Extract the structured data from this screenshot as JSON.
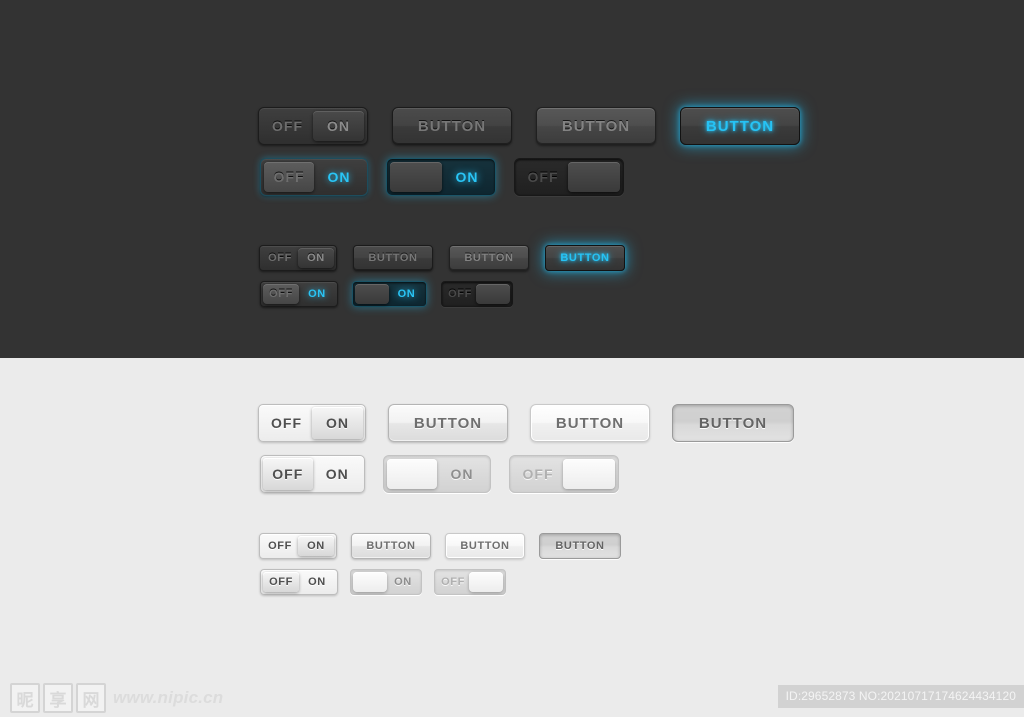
{
  "meta": {
    "background_dark": "#333333",
    "background_light": "#ebebeb",
    "accent_blue": "#29c5f6"
  },
  "labels": {
    "off": "OFF",
    "on": "ON",
    "button": "BUTTON"
  },
  "dark_section": {
    "row_large_1": [
      {
        "type": "toggle",
        "name": "toggle-off-on-knob-right",
        "left_label": "OFF",
        "right_label": "ON",
        "state": "on"
      },
      {
        "type": "button",
        "name": "button-default",
        "label": "BUTTON",
        "state": "default"
      },
      {
        "type": "button",
        "name": "button-hover",
        "label": "BUTTON",
        "state": "hover"
      },
      {
        "type": "button",
        "name": "button-active-glow",
        "label": "BUTTON",
        "state": "active"
      }
    ],
    "row_large_2": [
      {
        "type": "toggle",
        "name": "toggle-off-knob-left-on-blue",
        "left_label": "OFF",
        "right_label": "ON",
        "state": "on"
      },
      {
        "type": "pill",
        "name": "pill-on-blue",
        "label": "ON",
        "knob": "left",
        "state": "on"
      },
      {
        "type": "pill",
        "name": "pill-off-dim",
        "label": "OFF",
        "knob": "right",
        "state": "off"
      }
    ],
    "row_small_1": [
      {
        "type": "toggle",
        "name": "toggle-small-off-on",
        "left_label": "OFF",
        "right_label": "ON",
        "state": "on"
      },
      {
        "type": "button",
        "name": "button-small-default",
        "label": "BUTTON",
        "state": "default"
      },
      {
        "type": "button",
        "name": "button-small-hover",
        "label": "BUTTON",
        "state": "hover"
      },
      {
        "type": "button",
        "name": "button-small-active-glow",
        "label": "BUTTON",
        "state": "active"
      }
    ],
    "row_small_2": [
      {
        "type": "toggle",
        "name": "toggle-small-off-on-blue",
        "left_label": "OFF",
        "right_label": "ON",
        "state": "on"
      },
      {
        "type": "pill",
        "name": "pill-small-on-blue",
        "label": "ON",
        "knob": "left",
        "state": "on"
      },
      {
        "type": "pill",
        "name": "pill-small-off-dim",
        "label": "OFF",
        "knob": "right",
        "state": "off"
      }
    ]
  },
  "light_section": {
    "row_large_1": [
      {
        "type": "toggle",
        "name": "toggle-off-on-knob-right",
        "left_label": "OFF",
        "right_label": "ON",
        "state": "on"
      },
      {
        "type": "button",
        "name": "button-default",
        "label": "BUTTON",
        "state": "default"
      },
      {
        "type": "button",
        "name": "button-hover",
        "label": "BUTTON",
        "state": "hover"
      },
      {
        "type": "button",
        "name": "button-pressed",
        "label": "BUTTON",
        "state": "pressed"
      }
    ],
    "row_large_2": [
      {
        "type": "toggle",
        "name": "toggle-off-knob-left",
        "left_label": "OFF",
        "right_label": "ON",
        "state": "off"
      },
      {
        "type": "pill",
        "name": "pill-on",
        "label": "ON",
        "knob": "left",
        "state": "on"
      },
      {
        "type": "pill",
        "name": "pill-off",
        "label": "OFF",
        "knob": "right",
        "state": "off"
      }
    ],
    "row_small_1": [
      {
        "type": "toggle",
        "name": "toggle-small-off-on",
        "left_label": "OFF",
        "right_label": "ON",
        "state": "on"
      },
      {
        "type": "button",
        "name": "button-small-default",
        "label": "BUTTON",
        "state": "default"
      },
      {
        "type": "button",
        "name": "button-small-hover",
        "label": "BUTTON",
        "state": "hover"
      },
      {
        "type": "button",
        "name": "button-small-pressed",
        "label": "BUTTON",
        "state": "pressed"
      }
    ],
    "row_small_2": [
      {
        "type": "toggle",
        "name": "toggle-small-off-on",
        "left_label": "OFF",
        "right_label": "ON",
        "state": "off"
      },
      {
        "type": "pill",
        "name": "pill-small-on",
        "label": "ON",
        "knob": "left",
        "state": "on"
      },
      {
        "type": "pill",
        "name": "pill-small-off",
        "label": "OFF",
        "knob": "right",
        "state": "off"
      }
    ]
  },
  "footer": {
    "logo_chars": [
      "昵",
      "享",
      "网"
    ],
    "logo_url": "www.nipic.cn",
    "id_text": "ID:29652873 NO:20210717174624434120"
  }
}
